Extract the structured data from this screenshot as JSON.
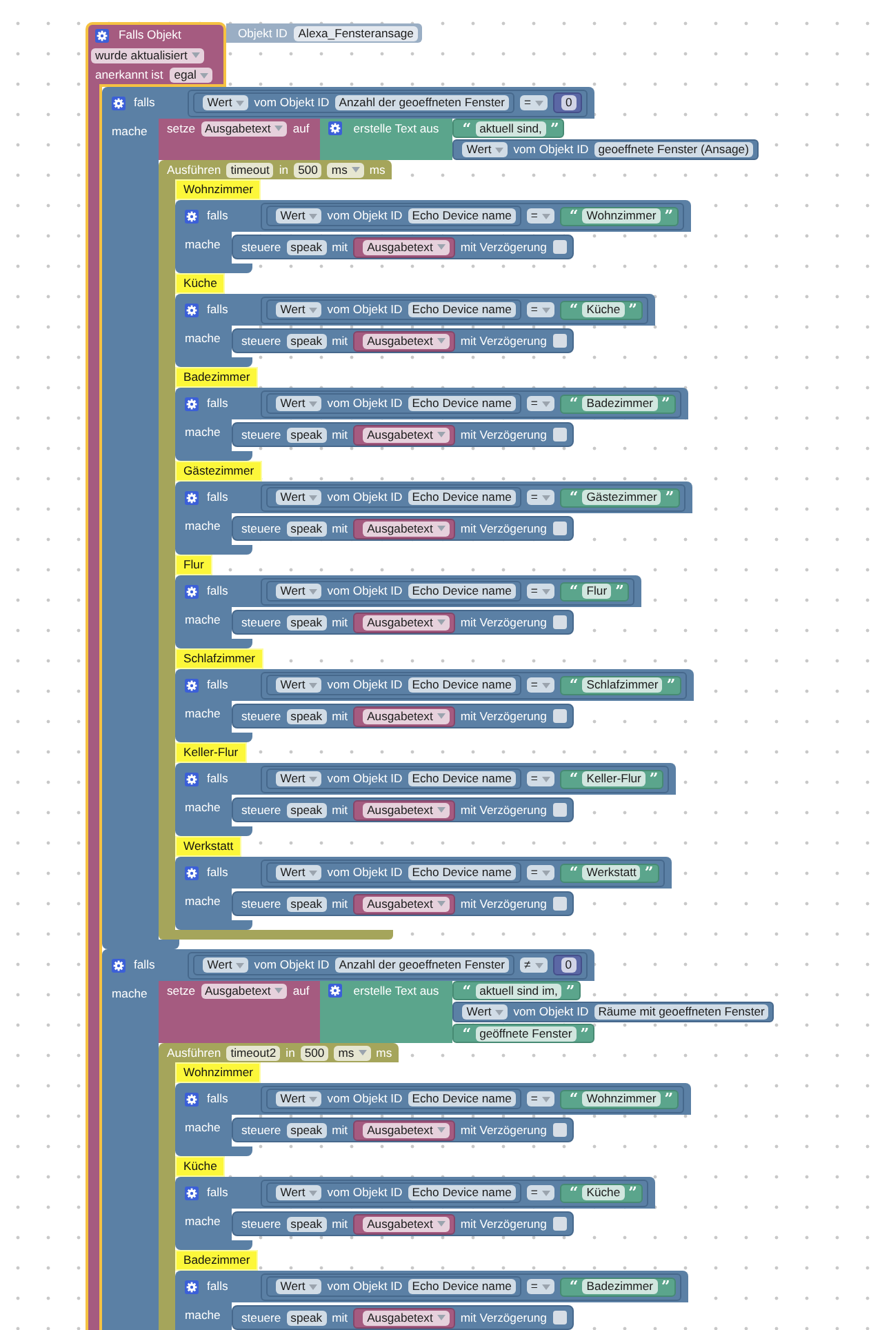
{
  "trigger": {
    "selected": true,
    "title": "Falls Objekt",
    "object_id_label": "Objekt ID",
    "object_id": "Alexa_Fensteransage",
    "event": "wurde aktualisiert",
    "ack_label": "anerkannt ist",
    "ack": "egal",
    "statements": [
      {
        "kind": "if",
        "label": "falls",
        "do_label": "mache",
        "condition": {
          "kind": "compare",
          "left": {
            "kind": "get_value",
            "attribute": "Wert",
            "from_label": "vom Objekt ID",
            "object": "Anzahl der geoeffneten Fenster"
          },
          "operator": "=",
          "right": {
            "kind": "number",
            "value": "0"
          }
        },
        "statements": [
          {
            "kind": "set",
            "label": "setze",
            "variable": "Ausgabetext",
            "to_label": "auf",
            "value": {
              "kind": "text_join",
              "label": "erstelle Text aus",
              "items": [
                {
                  "kind": "text",
                  "open_quote": "“",
                  "value": "aktuell sind,",
                  "close_quote": "”"
                },
                {
                  "kind": "get_value",
                  "attribute": "Wert",
                  "from_label": "vom Objekt ID",
                  "object": "geoeffnete Fenster (Ansage)"
                }
              ]
            }
          },
          {
            "kind": "timeout",
            "label": "Ausführen",
            "name": "timeout",
            "in_label": "in",
            "delay": "500",
            "unit": "ms",
            "unit_suffix": "ms",
            "statements": [
              {
                "kind": "comment",
                "text": "Wohnzimmer"
              },
              {
                "kind": "if",
                "label": "falls",
                "do_label": "mache",
                "condition": {
                  "kind": "compare",
                  "left": {
                    "kind": "get_value",
                    "attribute": "Wert",
                    "from_label": "vom Objekt ID",
                    "object": "Echo Device name"
                  },
                  "operator": "=",
                  "right": {
                    "kind": "text",
                    "open_quote": "“",
                    "value": "Wohnzimmer",
                    "close_quote": "”"
                  }
                },
                "statements": [
                  {
                    "kind": "control",
                    "label": "steuere",
                    "state": "speak",
                    "with_label": "mit",
                    "value": {
                      "kind": "variable",
                      "name": "Ausgabetext"
                    },
                    "delay_label": "mit Verzögerung",
                    "delay_checked": false
                  }
                ]
              },
              {
                "kind": "comment",
                "text": "Küche"
              },
              {
                "kind": "if",
                "label": "falls",
                "do_label": "mache",
                "condition": {
                  "kind": "compare",
                  "left": {
                    "kind": "get_value",
                    "attribute": "Wert",
                    "from_label": "vom Objekt ID",
                    "object": "Echo Device name"
                  },
                  "operator": "=",
                  "right": {
                    "kind": "text",
                    "open_quote": "“",
                    "value": "Küche",
                    "close_quote": "”"
                  }
                },
                "statements": [
                  {
                    "kind": "control",
                    "label": "steuere",
                    "state": "speak",
                    "with_label": "mit",
                    "value": {
                      "kind": "variable",
                      "name": "Ausgabetext"
                    },
                    "delay_label": "mit Verzögerung",
                    "delay_checked": false
                  }
                ]
              },
              {
                "kind": "comment",
                "text": "Badezimmer"
              },
              {
                "kind": "if",
                "label": "falls",
                "do_label": "mache",
                "condition": {
                  "kind": "compare",
                  "left": {
                    "kind": "get_value",
                    "attribute": "Wert",
                    "from_label": "vom Objekt ID",
                    "object": "Echo Device name"
                  },
                  "operator": "=",
                  "right": {
                    "kind": "text",
                    "open_quote": "“",
                    "value": "Badezimmer",
                    "close_quote": "”"
                  }
                },
                "statements": [
                  {
                    "kind": "control",
                    "label": "steuere",
                    "state": "speak",
                    "with_label": "mit",
                    "value": {
                      "kind": "variable",
                      "name": "Ausgabetext"
                    },
                    "delay_label": "mit Verzögerung",
                    "delay_checked": false
                  }
                ]
              },
              {
                "kind": "comment",
                "text": "Gästezimmer"
              },
              {
                "kind": "if",
                "label": "falls",
                "do_label": "mache",
                "condition": {
                  "kind": "compare",
                  "left": {
                    "kind": "get_value",
                    "attribute": "Wert",
                    "from_label": "vom Objekt ID",
                    "object": "Echo Device name"
                  },
                  "operator": "=",
                  "right": {
                    "kind": "text",
                    "open_quote": "“",
                    "value": "Gästezimmer",
                    "close_quote": "”"
                  }
                },
                "statements": [
                  {
                    "kind": "control",
                    "label": "steuere",
                    "state": "speak",
                    "with_label": "mit",
                    "value": {
                      "kind": "variable",
                      "name": "Ausgabetext"
                    },
                    "delay_label": "mit Verzögerung",
                    "delay_checked": false
                  }
                ]
              },
              {
                "kind": "comment",
                "text": "Flur"
              },
              {
                "kind": "if",
                "label": "falls",
                "do_label": "mache",
                "condition": {
                  "kind": "compare",
                  "left": {
                    "kind": "get_value",
                    "attribute": "Wert",
                    "from_label": "vom Objekt ID",
                    "object": "Echo Device name"
                  },
                  "operator": "=",
                  "right": {
                    "kind": "text",
                    "open_quote": "“",
                    "value": "Flur",
                    "close_quote": "”"
                  }
                },
                "statements": [
                  {
                    "kind": "control",
                    "label": "steuere",
                    "state": "speak",
                    "with_label": "mit",
                    "value": {
                      "kind": "variable",
                      "name": "Ausgabetext"
                    },
                    "delay_label": "mit Verzögerung",
                    "delay_checked": false
                  }
                ]
              },
              {
                "kind": "comment",
                "text": "Schlafzimmer"
              },
              {
                "kind": "if",
                "label": "falls",
                "do_label": "mache",
                "condition": {
                  "kind": "compare",
                  "left": {
                    "kind": "get_value",
                    "attribute": "Wert",
                    "from_label": "vom Objekt ID",
                    "object": "Echo Device name"
                  },
                  "operator": "=",
                  "right": {
                    "kind": "text",
                    "open_quote": "“",
                    "value": "Schlafzimmer",
                    "close_quote": "”"
                  }
                },
                "statements": [
                  {
                    "kind": "control",
                    "label": "steuere",
                    "state": "speak",
                    "with_label": "mit",
                    "value": {
                      "kind": "variable",
                      "name": "Ausgabetext"
                    },
                    "delay_label": "mit Verzögerung",
                    "delay_checked": false
                  }
                ]
              },
              {
                "kind": "comment",
                "text": "Keller-Flur"
              },
              {
                "kind": "if",
                "label": "falls",
                "do_label": "mache",
                "condition": {
                  "kind": "compare",
                  "left": {
                    "kind": "get_value",
                    "attribute": "Wert",
                    "from_label": "vom Objekt ID",
                    "object": "Echo Device name"
                  },
                  "operator": "=",
                  "right": {
                    "kind": "text",
                    "open_quote": "“",
                    "value": "Keller-Flur",
                    "close_quote": "”"
                  }
                },
                "statements": [
                  {
                    "kind": "control",
                    "label": "steuere",
                    "state": "speak",
                    "with_label": "mit",
                    "value": {
                      "kind": "variable",
                      "name": "Ausgabetext"
                    },
                    "delay_label": "mit Verzögerung",
                    "delay_checked": false
                  }
                ]
              },
              {
                "kind": "comment",
                "text": "Werkstatt"
              },
              {
                "kind": "if",
                "label": "falls",
                "do_label": "mache",
                "condition": {
                  "kind": "compare",
                  "left": {
                    "kind": "get_value",
                    "attribute": "Wert",
                    "from_label": "vom Objekt ID",
                    "object": "Echo Device name"
                  },
                  "operator": "=",
                  "right": {
                    "kind": "text",
                    "open_quote": "“",
                    "value": "Werkstatt",
                    "close_quote": "”"
                  }
                },
                "statements": [
                  {
                    "kind": "control",
                    "label": "steuere",
                    "state": "speak",
                    "with_label": "mit",
                    "value": {
                      "kind": "variable",
                      "name": "Ausgabetext"
                    },
                    "delay_label": "mit Verzögerung",
                    "delay_checked": false
                  }
                ]
              }
            ]
          }
        ]
      },
      {
        "kind": "if",
        "label": "falls",
        "do_label": "mache",
        "condition": {
          "kind": "compare",
          "left": {
            "kind": "get_value",
            "attribute": "Wert",
            "from_label": "vom Objekt ID",
            "object": "Anzahl der geoeffneten Fenster"
          },
          "operator": "≠",
          "right": {
            "kind": "number",
            "value": "0"
          }
        },
        "statements": [
          {
            "kind": "set",
            "label": "setze",
            "variable": "Ausgabetext",
            "to_label": "auf",
            "value": {
              "kind": "text_join",
              "label": "erstelle Text aus",
              "items": [
                {
                  "kind": "text",
                  "open_quote": "“",
                  "value": "aktuell sind im,",
                  "close_quote": "”"
                },
                {
                  "kind": "get_value",
                  "attribute": "Wert",
                  "from_label": "vom Objekt ID",
                  "object": "Räume mit geoeffneten Fenster"
                },
                {
                  "kind": "text",
                  "open_quote": "“",
                  "value": "geöffnete Fenster",
                  "close_quote": "”"
                }
              ]
            }
          },
          {
            "kind": "timeout",
            "label": "Ausführen",
            "name": "timeout2",
            "in_label": "in",
            "delay": "500",
            "unit": "ms",
            "unit_suffix": "ms",
            "statements": [
              {
                "kind": "comment",
                "text": "Wohnzimmer"
              },
              {
                "kind": "if",
                "label": "falls",
                "do_label": "mache",
                "condition": {
                  "kind": "compare",
                  "left": {
                    "kind": "get_value",
                    "attribute": "Wert",
                    "from_label": "vom Objekt ID",
                    "object": "Echo Device name"
                  },
                  "operator": "=",
                  "right": {
                    "kind": "text",
                    "open_quote": "“",
                    "value": "Wohnzimmer",
                    "close_quote": "”"
                  }
                },
                "statements": [
                  {
                    "kind": "control",
                    "label": "steuere",
                    "state": "speak",
                    "with_label": "mit",
                    "value": {
                      "kind": "variable",
                      "name": "Ausgabetext"
                    },
                    "delay_label": "mit Verzögerung",
                    "delay_checked": false
                  }
                ]
              },
              {
                "kind": "comment",
                "text": "Küche"
              },
              {
                "kind": "if",
                "label": "falls",
                "do_label": "mache",
                "condition": {
                  "kind": "compare",
                  "left": {
                    "kind": "get_value",
                    "attribute": "Wert",
                    "from_label": "vom Objekt ID",
                    "object": "Echo Device name"
                  },
                  "operator": "=",
                  "right": {
                    "kind": "text",
                    "open_quote": "“",
                    "value": "Küche",
                    "close_quote": "”"
                  }
                },
                "statements": [
                  {
                    "kind": "control",
                    "label": "steuere",
                    "state": "speak",
                    "with_label": "mit",
                    "value": {
                      "kind": "variable",
                      "name": "Ausgabetext"
                    },
                    "delay_label": "mit Verzögerung",
                    "delay_checked": false
                  }
                ]
              },
              {
                "kind": "comment",
                "text": "Badezimmer"
              },
              {
                "kind": "if",
                "label": "falls",
                "do_label": "mache",
                "condition": {
                  "kind": "compare",
                  "left": {
                    "kind": "get_value",
                    "attribute": "Wert",
                    "from_label": "vom Objekt ID",
                    "object": "Echo Device name"
                  },
                  "operator": "=",
                  "right": {
                    "kind": "text",
                    "open_quote": "“",
                    "value": "Badezimmer",
                    "close_quote": "”"
                  }
                },
                "statements": [
                  {
                    "kind": "control",
                    "label": "steuere",
                    "state": "speak",
                    "with_label": "mit",
                    "value": {
                      "kind": "variable",
                      "name": "Ausgabetext"
                    },
                    "delay_label": "mit Verzögerung",
                    "delay_checked": false
                  }
                ]
              }
            ]
          }
        ]
      }
    ]
  }
}
